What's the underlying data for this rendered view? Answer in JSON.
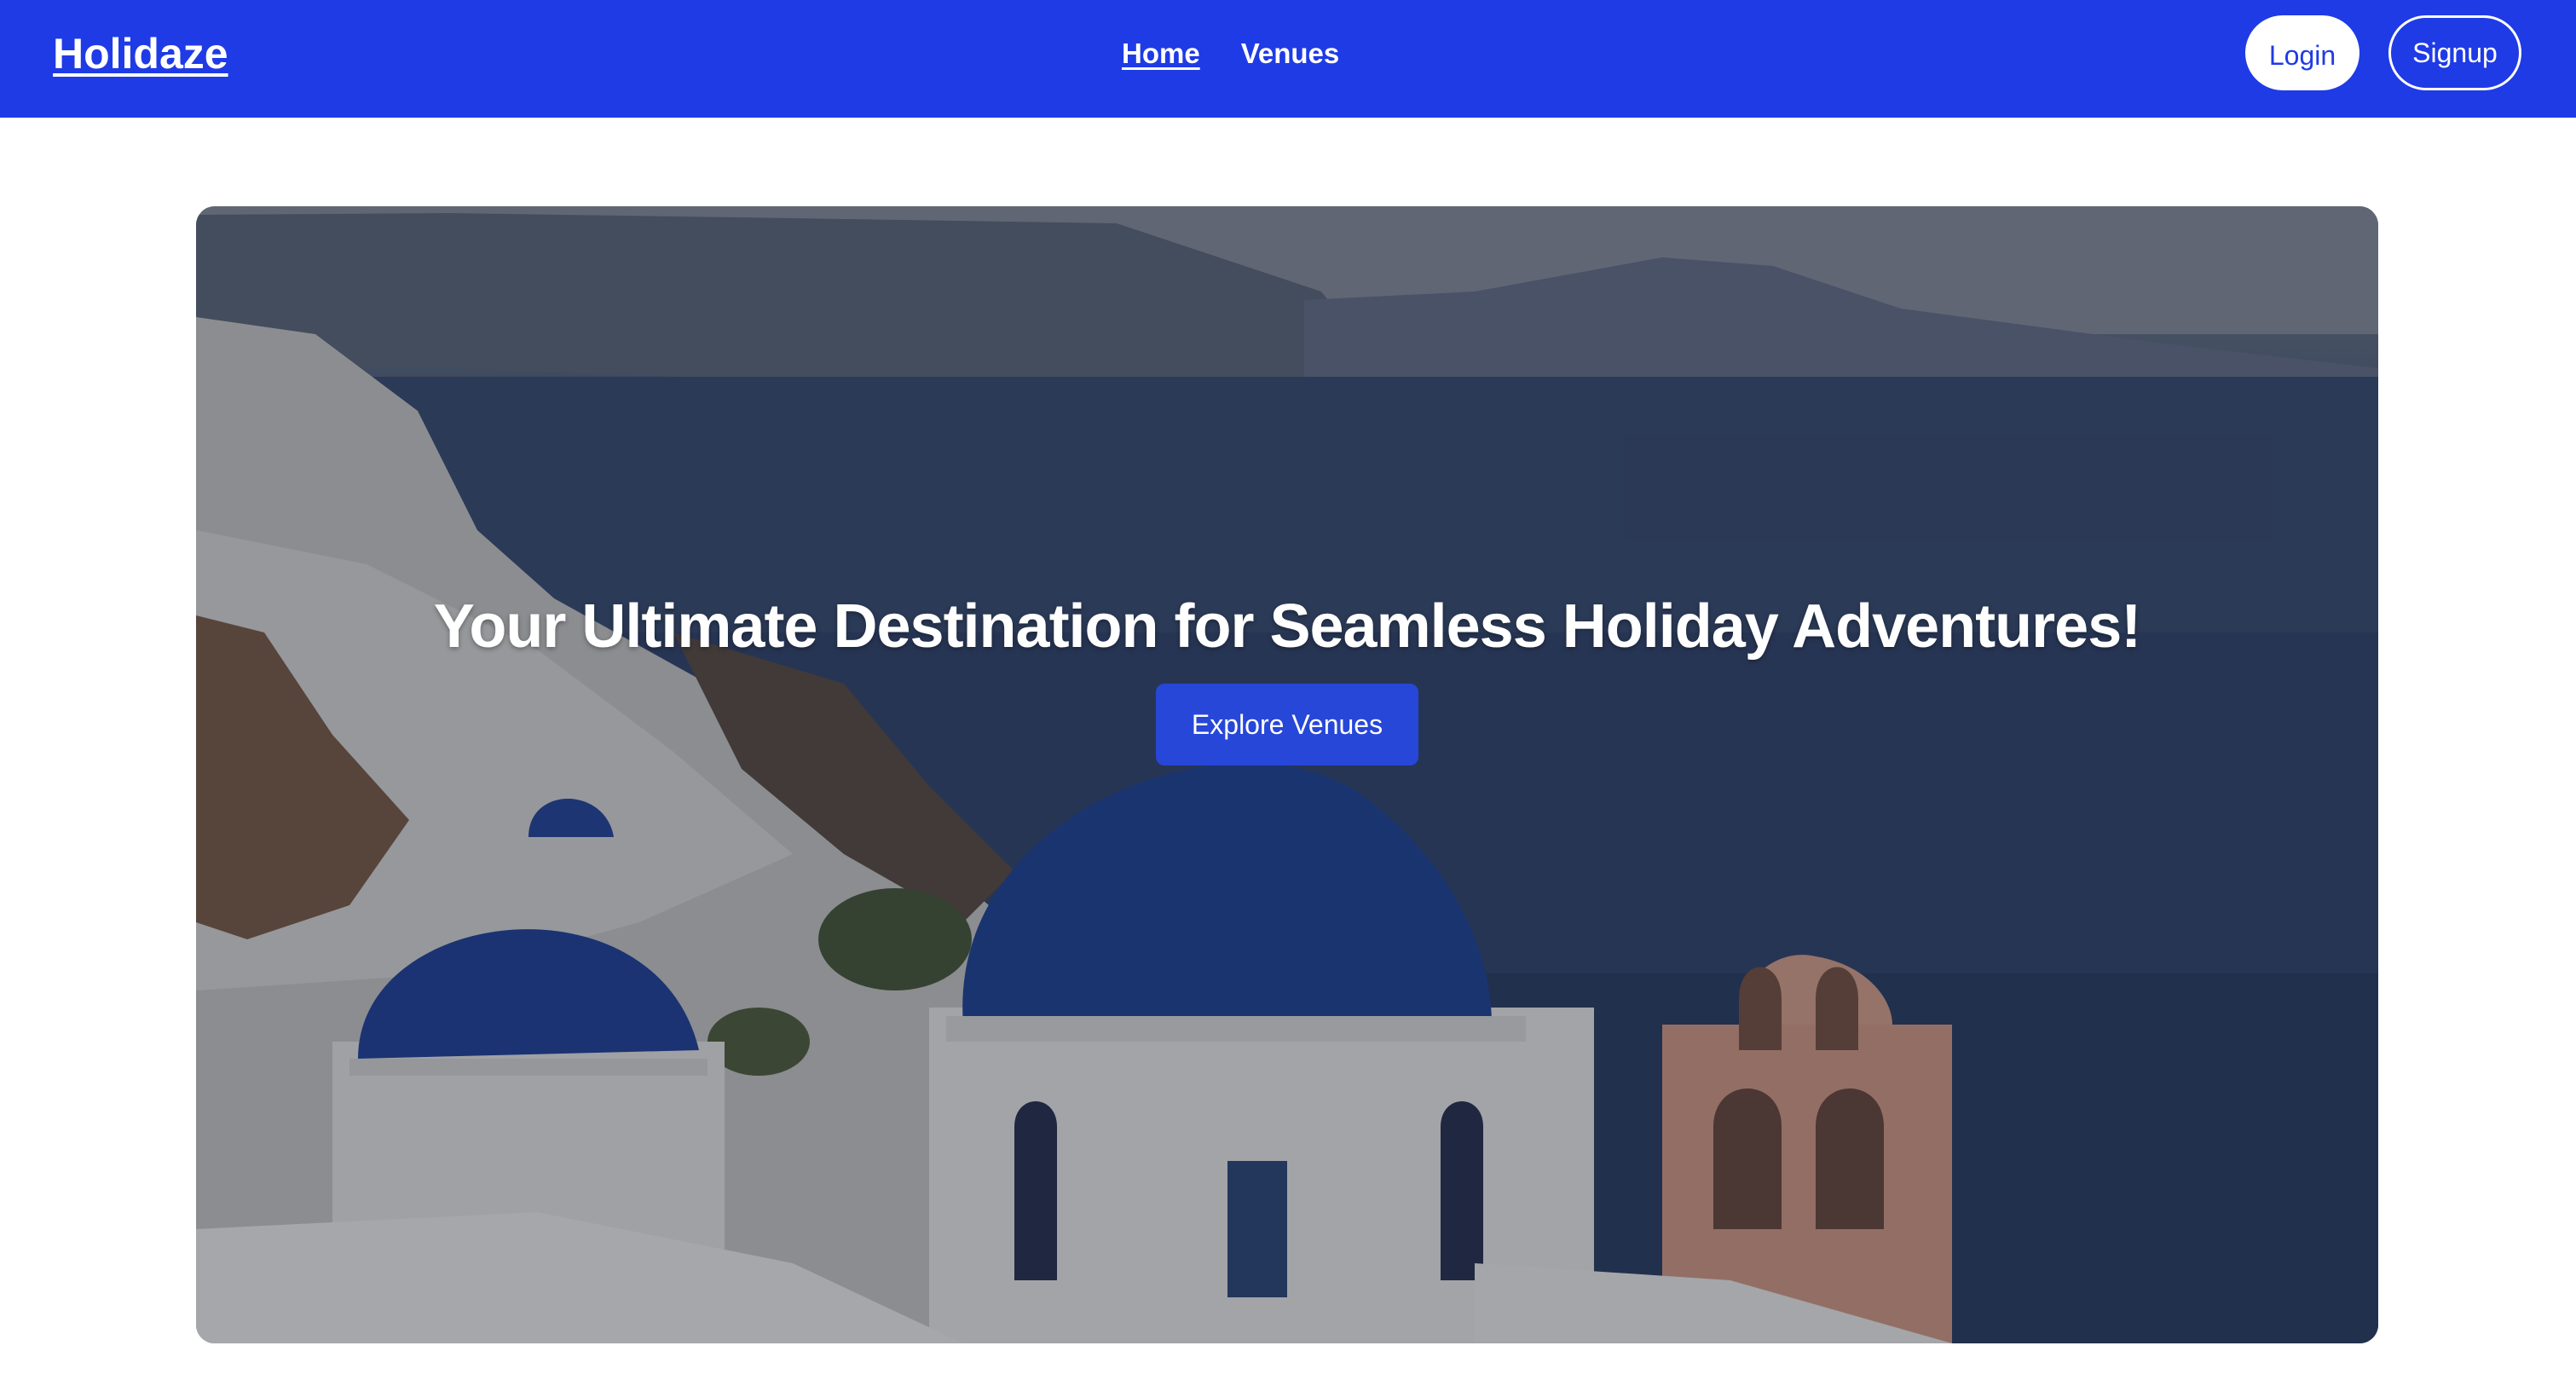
{
  "header": {
    "brand": "Holidaze",
    "nav": [
      {
        "label": "Home",
        "active": true
      },
      {
        "label": "Venues",
        "active": false
      }
    ],
    "login_label": "Login",
    "signup_label": "Signup"
  },
  "hero": {
    "title": "Your Ultimate Destination for Seamless Holiday Adventures!",
    "cta_label": "Explore Venues"
  },
  "colors": {
    "brand_blue": "#1f3be6",
    "cta_blue": "#2747d8",
    "background": "#ffffff"
  }
}
